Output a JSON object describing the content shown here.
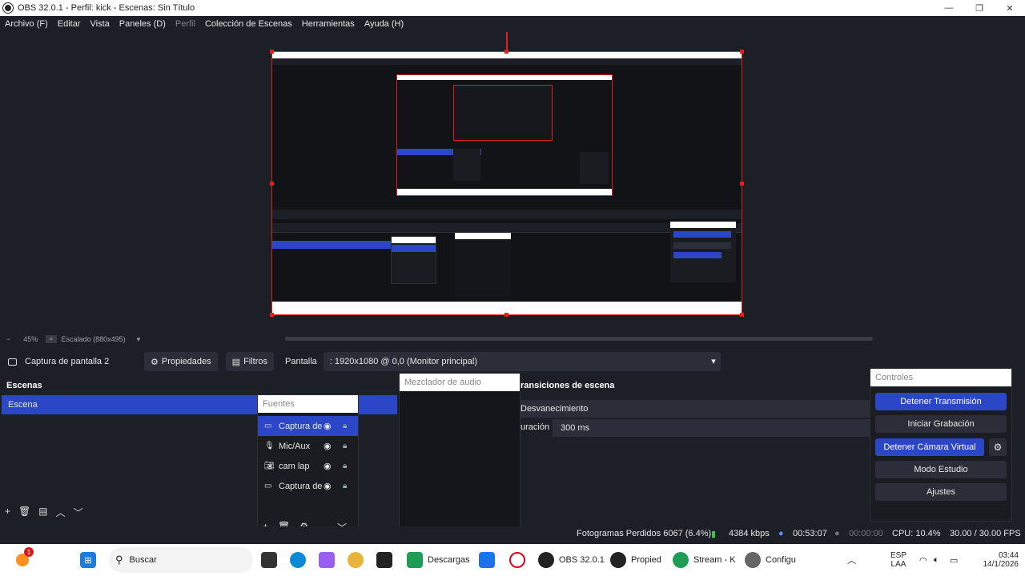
{
  "window": {
    "title": "OBS 32.0.1 - Perfil: kick - Escenas: Sin Título",
    "minimize": "—",
    "maximize": "❐",
    "close": "✕"
  },
  "menu": [
    "Archivo (F)",
    "Editar",
    "Vista",
    "Paneles (D)",
    "Perfil",
    "Colección de Escenas",
    "Herramientas",
    "Ayuda (H)"
  ],
  "zoom": {
    "minus": "−",
    "level": "45%",
    "plus": "+",
    "scale": "Escalado (880x495)"
  },
  "source_bar": {
    "name": "Captura de pantalla 2",
    "properties": "Propiedades",
    "filters": "Filtros",
    "display_label": "Pantalla",
    "display_value": ": 1920x1080 @ 0,0 (Monitor principal)"
  },
  "scenes": {
    "title": "Escenas",
    "items": [
      "Escena"
    ]
  },
  "sources": {
    "title": "Fuentes",
    "items": [
      {
        "label": "Captura de",
        "icon": "monitor-icon"
      },
      {
        "label": "Mic/Aux",
        "icon": "microphone-icon"
      },
      {
        "label": "cam lap",
        "icon": "camera-icon"
      },
      {
        "label": "Captura de",
        "icon": "monitor-icon"
      }
    ]
  },
  "mixer": {
    "title": "Mezclador de audio"
  },
  "transitions": {
    "title": "ransiciones de escena",
    "type": "Desvanecimiento",
    "duration_label": "uración",
    "duration_value": "300 ms"
  },
  "controls": {
    "title": "Controles",
    "stop_stream": "Detener Transmisión",
    "start_recording": "Iniciar Grabación",
    "stop_virtual_cam": "Detener Cámara Virtual",
    "studio_mode": "Modo Estudio",
    "settings": "Ajustes"
  },
  "status": {
    "dropped": "Fotogramas Perdidos 6067 (6.4%)",
    "bitrate": "4384 kbps",
    "stream_time": "00:53:07",
    "rec_time": "00:00:00",
    "cpu": "CPU: 10.4%",
    "fps": "30.00 / 30.00 FPS"
  },
  "taskbar": {
    "search": "Buscar",
    "downloads": "Descargas",
    "obs": "OBS 32.0.1",
    "properties": "Propied",
    "stream": "Stream - K",
    "config": "Configu",
    "lang_top": "ESP",
    "lang_bottom": "LAA",
    "time": "03:44",
    "date": "14/1/2026",
    "notification_count": "1"
  },
  "colors": {
    "accent": "#2c46c8",
    "selection_border": "#e02020",
    "background": "#1d1f26"
  }
}
